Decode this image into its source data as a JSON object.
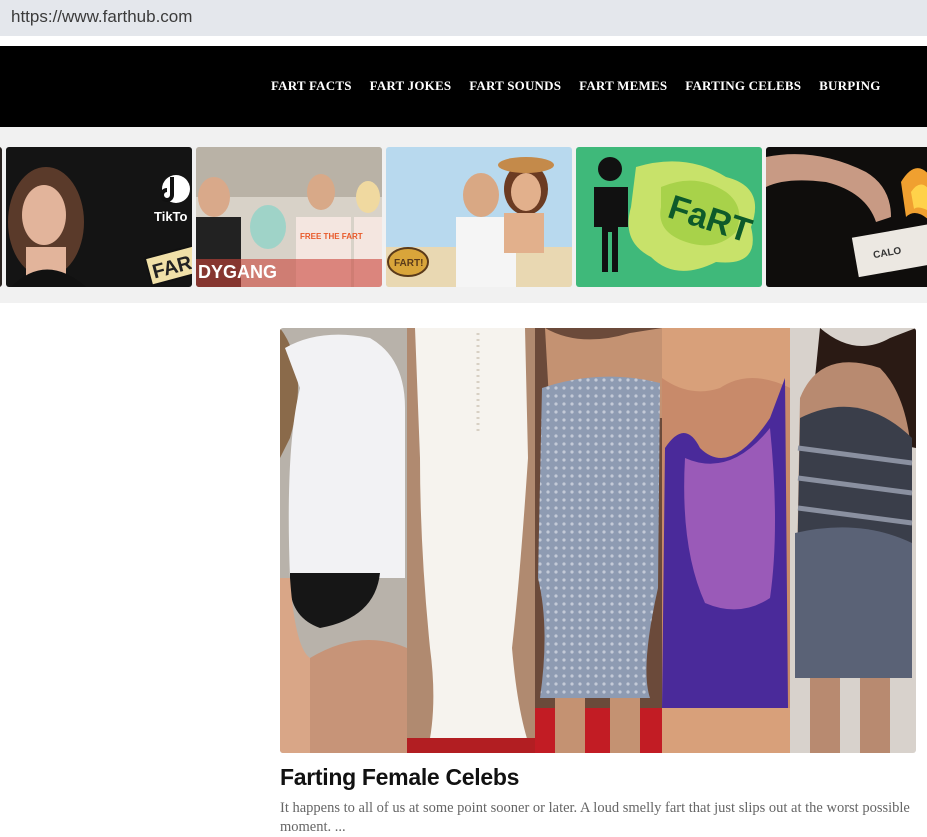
{
  "browser": {
    "url": "https://www.farthub.com"
  },
  "nav": {
    "items": [
      {
        "label": "FART FACTS"
      },
      {
        "label": "FART JOKES"
      },
      {
        "label": "FART SOUNDS"
      },
      {
        "label": "FART MEMES"
      },
      {
        "label": "FARTING CELEBS"
      },
      {
        "label": "BURPING"
      }
    ]
  },
  "thumbnails": [
    {
      "text_1": "TikTo",
      "text_2": "FAR"
    },
    {
      "text_1": "DYGANG",
      "text_2": "FREE THE FART"
    },
    {
      "text_1": "FART!"
    },
    {
      "text_1": "FaRT"
    },
    {
      "text_1": "CALO"
    }
  ],
  "featured": {
    "title": "Farting Female Celebs",
    "excerpt": "It happens to all of us at some point sooner or later. A loud smelly fart that just slips out at the worst possible moment. ..."
  },
  "colors": {
    "nav_bg": "#000000",
    "nav_text": "#ffffff",
    "urlbar_bg": "#e4e7ec",
    "strip_bg": "#f1f1f1",
    "excerpt_text": "#666666"
  }
}
